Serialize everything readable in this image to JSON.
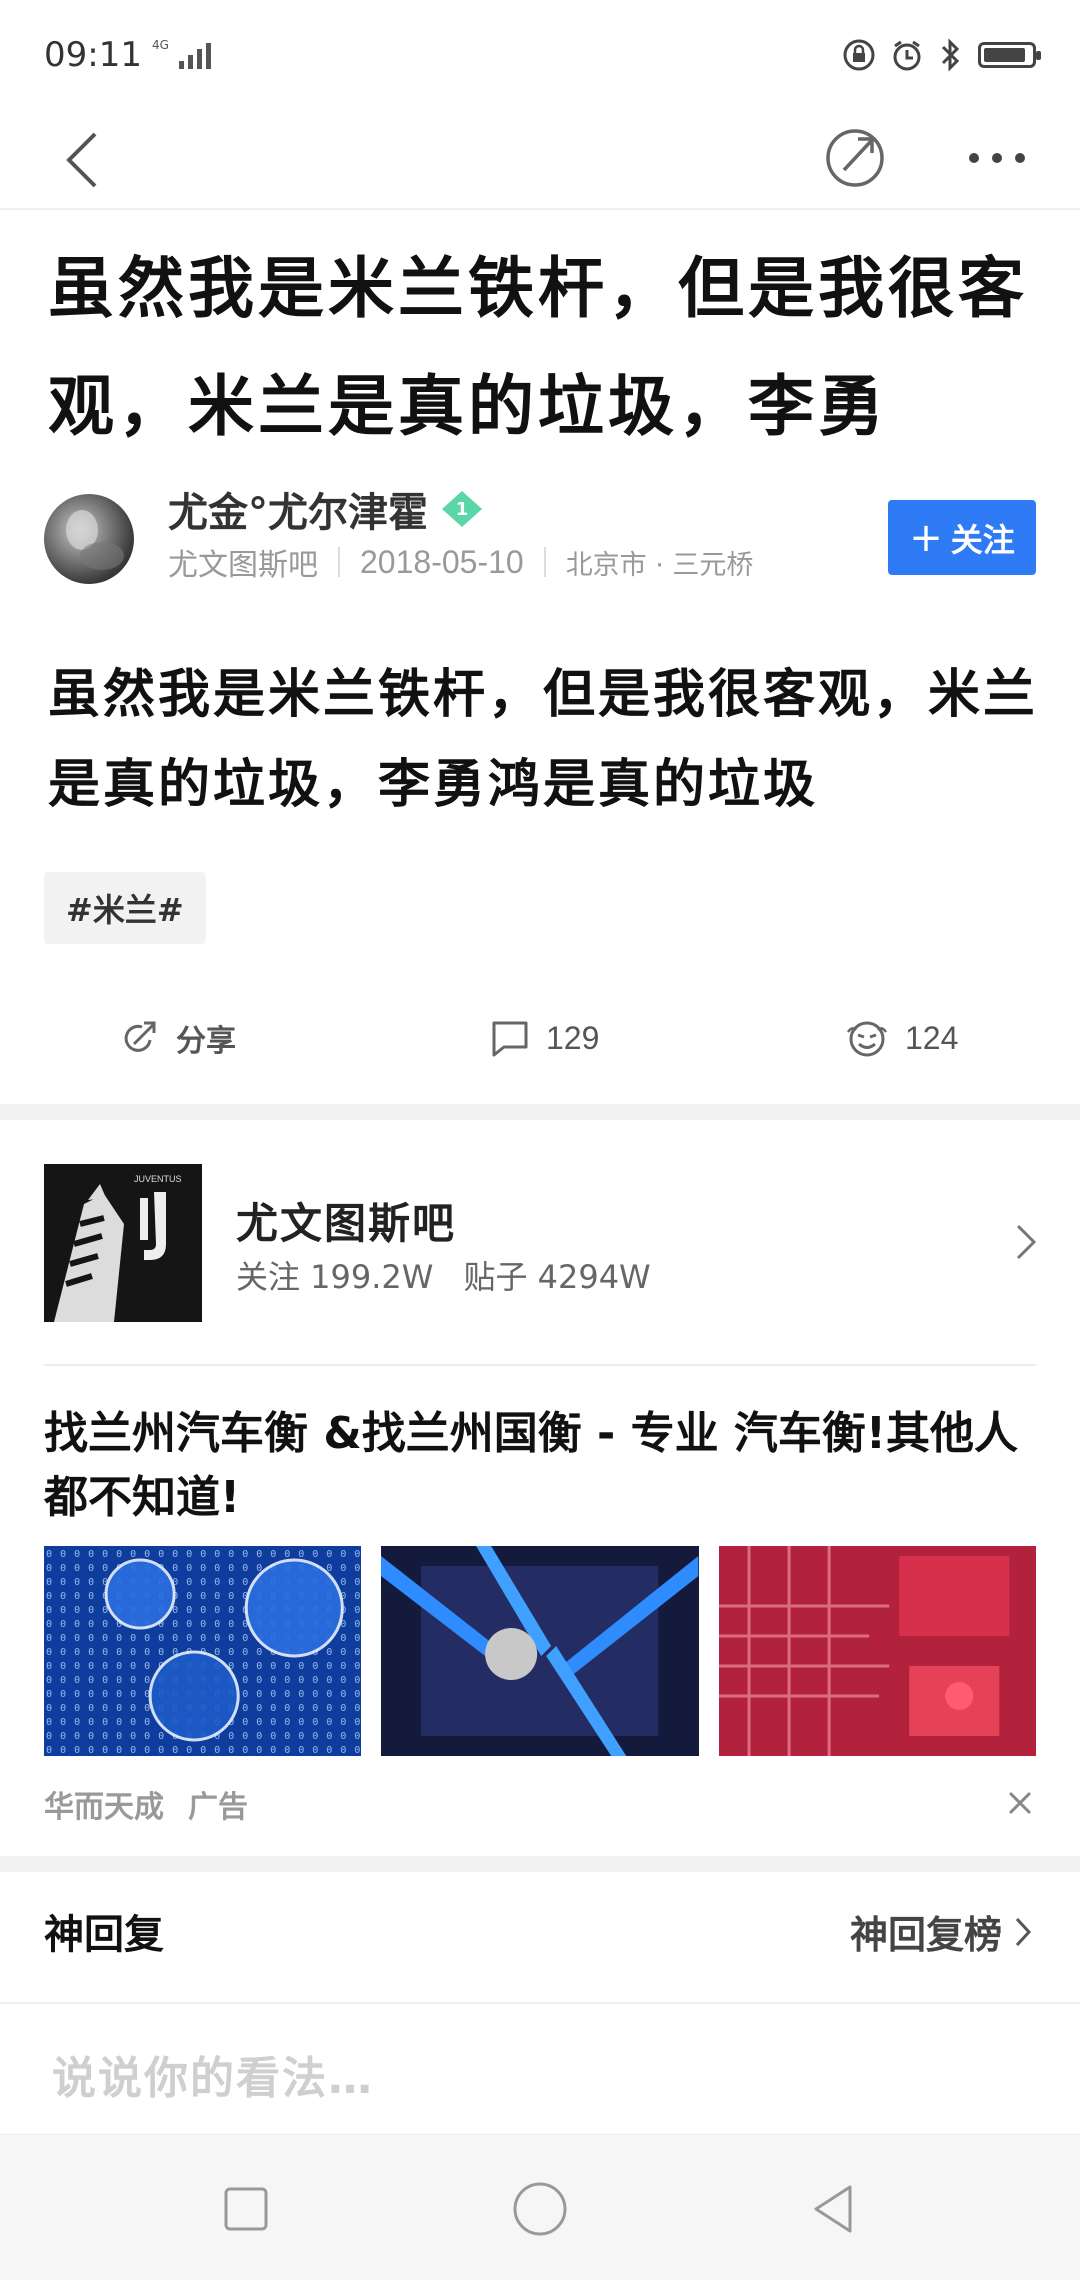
{
  "status_bar": {
    "time": "09:11",
    "network": "4G",
    "battery_level": 0.9
  },
  "post": {
    "title": "虽然我是米兰铁杆，但是我很客观，米兰是真的垃圾，李勇",
    "author": {
      "name": "尤金°尤尔津霍",
      "level": "1",
      "forum": "尤文图斯吧",
      "date": "2018-05-10",
      "location": "北京市 · 三元桥"
    },
    "follow_label": "关注",
    "body": "虽然我是米兰铁杆，但是我很客观，米兰是真的垃圾，李勇鸿是真的垃圾",
    "tag": "#米兰#",
    "actions": {
      "share_label": "分享",
      "comments_count": "129",
      "likes_count": "124"
    }
  },
  "forum_card": {
    "name": "尤文图斯吧",
    "followers_label": "关注 199.2W",
    "posts_label": "贴子 4294W",
    "logo_text": "JUVENTUS"
  },
  "ad": {
    "title": "找兰州汽车衡 &找兰州国衡 - 专业 汽车衡!其他人都不知道!",
    "source": "华而天成",
    "ad_label": "广告"
  },
  "god_replies": {
    "title": "神回复",
    "rank_label": "神回复榜"
  },
  "comment_box": {
    "placeholder": "说说你的看法…"
  },
  "colors": {
    "accent": "#2f7bf5",
    "level_badge": "#5bd6a8"
  }
}
